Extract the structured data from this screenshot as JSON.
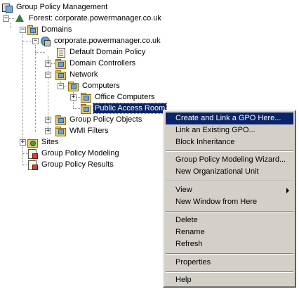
{
  "tree": {
    "root": "Group Policy Management",
    "forest": "Forest: corporate.powermanager.co.uk",
    "domains": "Domains",
    "domain": "corporate.powermanager.co.uk",
    "default_policy": "Default Domain Policy",
    "domain_controllers": "Domain Controllers",
    "network": "Network",
    "computers": "Computers",
    "office_computers": "Office Computers",
    "public_access_room": "Public Access Room",
    "gpo": "Group Policy Objects",
    "wmi": "WMI Filters",
    "sites": "Sites",
    "modeling": "Group Policy Modeling",
    "results": "Group Policy Results",
    "expand_plus": "+",
    "expand_minus": "−"
  },
  "menu": {
    "create_link": "Create and Link a GPO Here...",
    "link_existing": "Link an Existing GPO...",
    "block_inheritance": "Block Inheritance",
    "modeling_wizard": "Group Policy Modeling Wizard...",
    "new_ou": "New Organizational Unit",
    "view": "View",
    "new_window": "New Window from Here",
    "delete": "Delete",
    "rename": "Rename",
    "refresh": "Refresh",
    "properties": "Properties",
    "help": "Help"
  },
  "colors": {
    "selection": "#0a246a",
    "menu_bg": "#d4d0c8"
  }
}
